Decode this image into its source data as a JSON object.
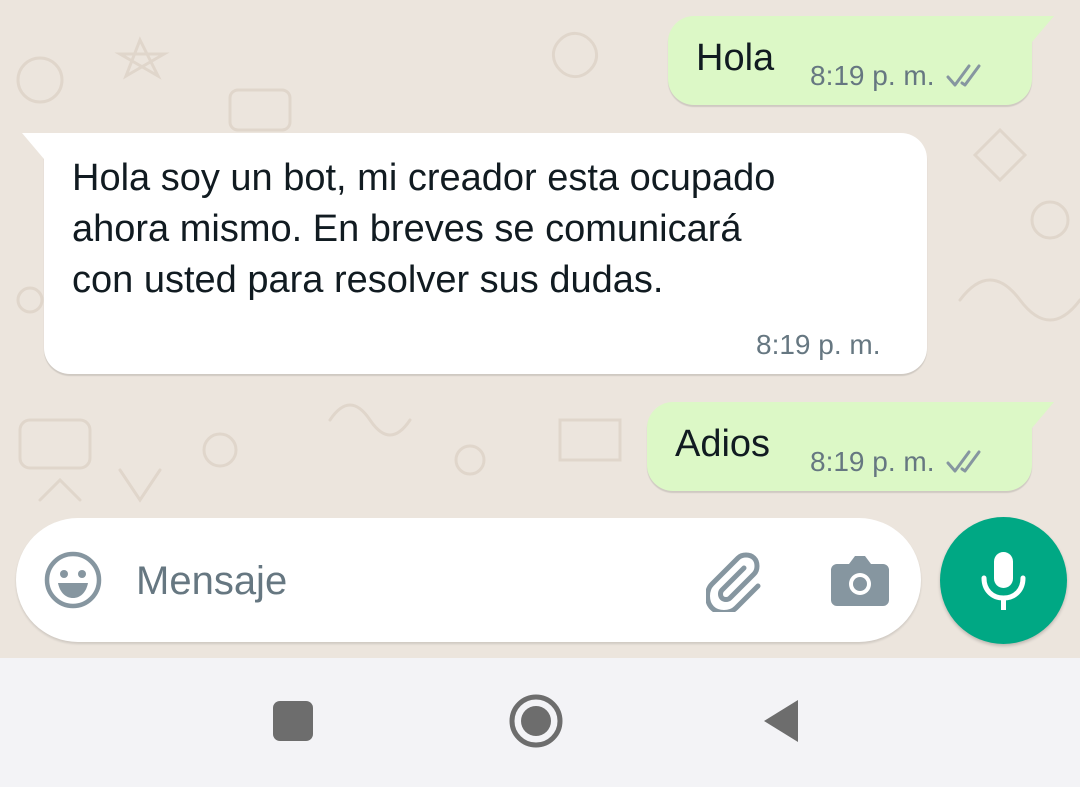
{
  "conversation": {
    "messages": [
      {
        "direction": "outgoing",
        "text": "Hola",
        "time": "8:19 p. m.",
        "status": "read-ticks-icon"
      },
      {
        "direction": "incoming",
        "lines": [
          "Hola soy un bot, mi creador esta ocupado",
          "ahora mismo. En breves se comunicará",
          "con usted para resolver sus dudas."
        ],
        "time": "8:19 p. m."
      },
      {
        "direction": "outgoing",
        "text": "Adios",
        "time": "8:19 p. m.",
        "status": "read-ticks-icon"
      }
    ]
  },
  "composer": {
    "placeholder": "Mensaje",
    "emoji_icon": "emoji-icon",
    "attach_icon": "paperclip-icon",
    "camera_icon": "camera-icon",
    "mic_icon": "microphone-icon"
  },
  "navigation": {
    "recents_icon": "square-icon",
    "home_icon": "home-circle-icon",
    "back_icon": "back-triangle-icon"
  },
  "colors": {
    "outgoing_bubble": "#dcf8c6",
    "incoming_bubble": "#ffffff",
    "chat_background": "#ece5dd",
    "accent_green": "#00a884",
    "meta_gray": "#667781",
    "ticks_gray": "#8696a0"
  }
}
